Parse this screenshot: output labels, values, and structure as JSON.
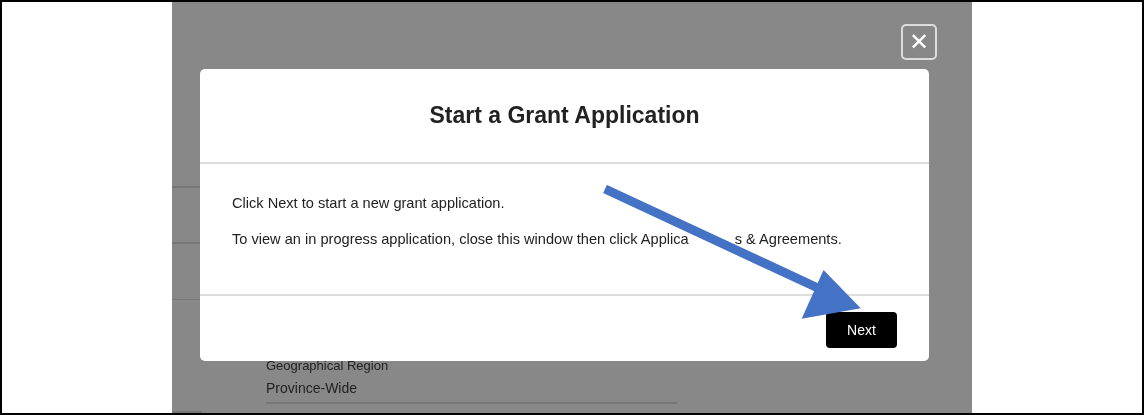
{
  "background": {
    "field_label": "Geographical Region",
    "field_value": "Province-Wide"
  },
  "close_button": {
    "label": "✕"
  },
  "dialog": {
    "title": "Start a Grant Application",
    "paragraphs": [
      {
        "text": "Click Next to start a new grant application."
      },
      {
        "text": "To view an in progress application, close this window then click Applica",
        "text_after_arrow": "s & Agreements."
      }
    ],
    "buttons": [
      "Next"
    ]
  },
  "annotation": {
    "kind": "arrow"
  }
}
